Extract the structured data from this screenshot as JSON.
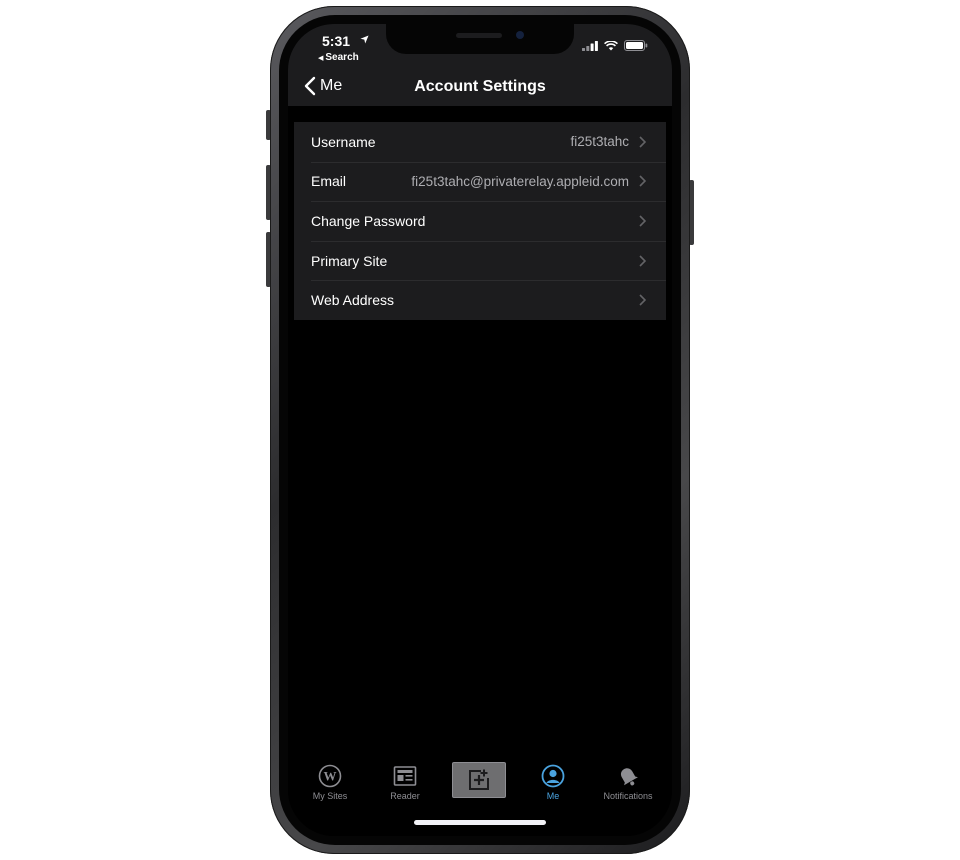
{
  "status_bar": {
    "time": "5:31",
    "back_app_label": "Search"
  },
  "nav": {
    "back_label": "Me",
    "title": "Account Settings"
  },
  "settings": [
    {
      "label": "Username",
      "value": "fi25t3tahc"
    },
    {
      "label": "Email",
      "value": "fi25t3tahc@privaterelay.appleid.com"
    },
    {
      "label": "Change Password",
      "value": ""
    },
    {
      "label": "Primary Site",
      "value": ""
    },
    {
      "label": "Web Address",
      "value": ""
    }
  ],
  "tabs": [
    {
      "label": "My Sites",
      "icon": "wordpress-icon",
      "active": false
    },
    {
      "label": "Reader",
      "icon": "reader-icon",
      "active": false
    },
    {
      "label": "",
      "icon": "new-post-icon",
      "active": false
    },
    {
      "label": "Me",
      "icon": "person-icon",
      "active": true
    },
    {
      "label": "Notifications",
      "icon": "bell-icon",
      "active": false
    }
  ],
  "colors": {
    "background": "#000000",
    "group_background": "#1c1c1e",
    "secondary_text": "#aeaeb2",
    "active_tab": "#4aa3df"
  }
}
